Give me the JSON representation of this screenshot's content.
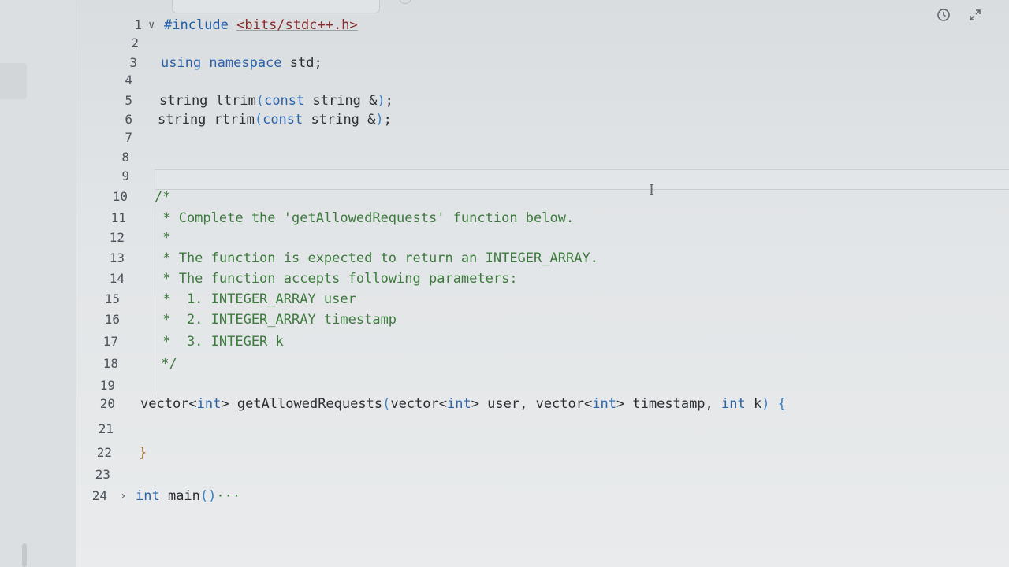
{
  "editor": {
    "lines": [
      {
        "num": "1",
        "fold": "∨",
        "parts": [
          {
            "t": "#include ",
            "c": "inc"
          },
          {
            "t": "<bits/stdc++.h>",
            "c": "hdr"
          }
        ]
      },
      {
        "num": "2",
        "parts": []
      },
      {
        "num": "3",
        "parts": [
          {
            "t": "using namespace ",
            "c": "kw"
          },
          {
            "t": "std;",
            "c": ""
          }
        ]
      },
      {
        "num": "4",
        "parts": []
      },
      {
        "num": "5",
        "parts": [
          {
            "t": "string ltrim",
            "c": ""
          },
          {
            "t": "(",
            "c": "paren"
          },
          {
            "t": "const",
            "c": "kw"
          },
          {
            "t": " string &",
            "c": ""
          },
          {
            "t": ")",
            "c": "paren"
          },
          {
            "t": ";",
            "c": ""
          }
        ]
      },
      {
        "num": "6",
        "parts": [
          {
            "t": "string rtrim",
            "c": ""
          },
          {
            "t": "(",
            "c": "paren"
          },
          {
            "t": "const",
            "c": "kw"
          },
          {
            "t": " string &",
            "c": ""
          },
          {
            "t": ")",
            "c": "paren"
          },
          {
            "t": ";",
            "c": ""
          }
        ]
      },
      {
        "num": "7",
        "parts": []
      },
      {
        "num": "8",
        "parts": []
      },
      {
        "num": "9",
        "parts": []
      },
      {
        "num": "10",
        "parts": [
          {
            "t": "/*",
            "c": "cmt"
          }
        ]
      },
      {
        "num": "11",
        "parts": [
          {
            "t": " * Complete the 'getAllowedRequests' function below.",
            "c": "cmt"
          }
        ]
      },
      {
        "num": "12",
        "parts": [
          {
            "t": " *",
            "c": "cmt"
          }
        ]
      },
      {
        "num": "13",
        "parts": [
          {
            "t": " * The function is expected to return an INTEGER_ARRAY.",
            "c": "cmt"
          }
        ]
      },
      {
        "num": "14",
        "parts": [
          {
            "t": " * The function accepts following parameters:",
            "c": "cmt"
          }
        ]
      },
      {
        "num": "15",
        "parts": [
          {
            "t": " *  1. INTEGER_ARRAY user",
            "c": "cmt"
          }
        ]
      },
      {
        "num": "16",
        "parts": [
          {
            "t": " *  2. INTEGER_ARRAY timestamp",
            "c": "cmt"
          }
        ]
      },
      {
        "num": "17",
        "parts": [
          {
            "t": " *  3. INTEGER k",
            "c": "cmt"
          }
        ]
      },
      {
        "num": "18",
        "parts": [
          {
            "t": " */",
            "c": "cmt"
          }
        ]
      },
      {
        "num": "19",
        "parts": []
      },
      {
        "num": "20",
        "parts": [
          {
            "t": "vector<",
            "c": ""
          },
          {
            "t": "int",
            "c": "kw"
          },
          {
            "t": "> getAllowedRequests",
            "c": ""
          },
          {
            "t": "(",
            "c": "paren"
          },
          {
            "t": "vector<",
            "c": ""
          },
          {
            "t": "int",
            "c": "kw"
          },
          {
            "t": "> user, vector<",
            "c": ""
          },
          {
            "t": "int",
            "c": "kw"
          },
          {
            "t": "> timestamp, ",
            "c": ""
          },
          {
            "t": "int",
            "c": "kw"
          },
          {
            "t": " k",
            "c": ""
          },
          {
            "t": ")",
            "c": "paren"
          },
          {
            "t": " {",
            "c": "paren"
          }
        ]
      },
      {
        "num": "21",
        "parts": []
      },
      {
        "num": "22",
        "parts": [
          {
            "t": "}",
            "c": "brace"
          }
        ]
      },
      {
        "num": "23",
        "parts": []
      },
      {
        "num": "24",
        "fold": "›",
        "parts": [
          {
            "t": "int",
            "c": "kw"
          },
          {
            "t": " main",
            "c": ""
          },
          {
            "t": "()",
            "c": "paren"
          },
          {
            "t": "···",
            "c": "cmt"
          }
        ]
      }
    ]
  },
  "toolbar": {
    "icons": [
      "history-icon",
      "expand-icon"
    ]
  }
}
